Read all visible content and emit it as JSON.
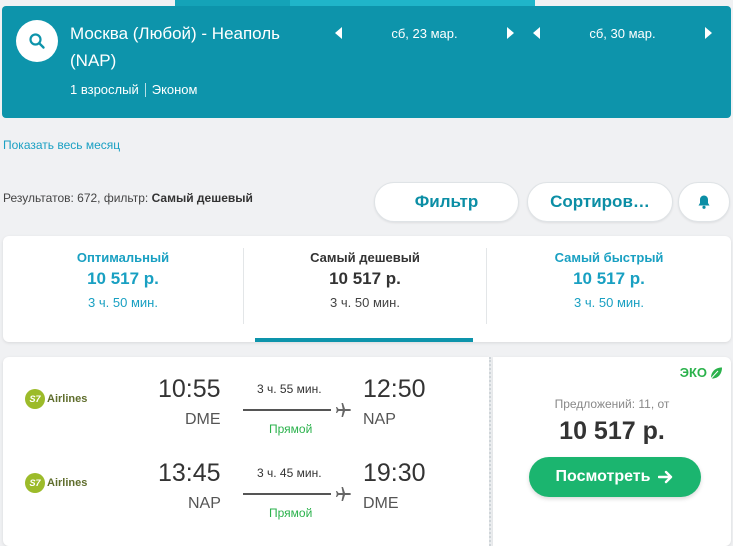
{
  "search": {
    "route": "Москва (Любой) - Неаполь (NAP)",
    "passengers": "1 взрослый",
    "cabin": "Эконом",
    "depart_date": "сб, 23 мар.",
    "return_date": "сб, 30 мар."
  },
  "links": {
    "show_month": "Показать весь месяц"
  },
  "results": {
    "prefix": "Результатов: 672, фильтр:",
    "filter_name": "Самый дешевый"
  },
  "buttons": {
    "filter": "Фильтр",
    "sort": "Сортиров…"
  },
  "tabs": [
    {
      "title": "Оптимальный",
      "price": "10 517 р.",
      "duration": "3 ч. 50 мин."
    },
    {
      "title": "Самый дешевый",
      "price": "10 517 р.",
      "duration": "3 ч. 50 мин."
    },
    {
      "title": "Самый быстрый",
      "price": "10 517 р.",
      "duration": "3 ч. 50 мин."
    }
  ],
  "ticket": {
    "eco_label": "ЭКО",
    "offers": "Предложений: 11, от",
    "price": "10 517 р.",
    "view_button": "Посмотреть",
    "segments": [
      {
        "airline": "Airlines",
        "airline_mark": "S7",
        "dep_time": "10:55",
        "dep_code": "DME",
        "duration": "3 ч. 55 мин.",
        "type": "Прямой",
        "arr_time": "12:50",
        "arr_code": "NAP"
      },
      {
        "airline": "Airlines",
        "airline_mark": "S7",
        "dep_time": "13:45",
        "dep_code": "NAP",
        "duration": "3 ч. 45 мин.",
        "type": "Прямой",
        "arr_time": "19:30",
        "arr_code": "DME"
      }
    ]
  },
  "colors": {
    "header": "#0d94ab",
    "accent": "#19a0c2",
    "green": "#1bb56f",
    "direct": "#2bb24c"
  }
}
